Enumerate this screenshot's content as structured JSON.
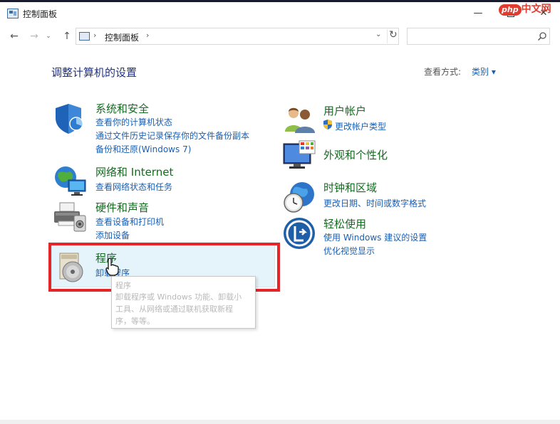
{
  "window": {
    "title": "控制面板",
    "minimize": "—",
    "close": "✕"
  },
  "watermark": {
    "badge": "php",
    "text": "中文网"
  },
  "nav": {
    "back": "←",
    "forward": "→",
    "recent": "⌄",
    "up": "↑",
    "address_text": "控制面板",
    "address_sep": "›",
    "address_dropdown": "⌄",
    "refresh": "↻",
    "search_placeholder": ""
  },
  "content": {
    "heading": "调整计算机的设置",
    "view_by_label": "查看方式:",
    "view_by_value": "类别 ▾"
  },
  "categories": {
    "security": {
      "title": "系统和安全",
      "links": [
        "查看你的计算机状态",
        "通过文件历史记录保存你的文件备份副本",
        "备份和还原(Windows 7)"
      ]
    },
    "network": {
      "title": "网络和 Internet",
      "links": [
        "查看网络状态和任务"
      ]
    },
    "hardware": {
      "title": "硬件和声音",
      "links": [
        "查看设备和打印机",
        "添加设备"
      ]
    },
    "programs": {
      "title": "程序",
      "links": [
        "卸载程序"
      ]
    },
    "accounts": {
      "title": "用户帐户",
      "links": [
        "更改帐户类型"
      ]
    },
    "appearance": {
      "title": "外观和个性化",
      "links": []
    },
    "clock": {
      "title": "时钟和区域",
      "links": [
        "更改日期、时间或数字格式"
      ]
    },
    "ease": {
      "title": "轻松使用",
      "links": [
        "使用 Windows 建议的设置",
        "优化视觉显示"
      ]
    }
  },
  "tooltip": {
    "title": "程序",
    "line1": "卸载程序或 Windows 功能、卸载小",
    "line2": "工具、从网络或通过联机获取新程",
    "line3": "序，等等。"
  },
  "colors": {
    "category_title": "#146b20",
    "link": "#1a5fb4",
    "heading": "#1e3287",
    "hover_bg": "#e5f3fb",
    "annotation_red": "#e4262a"
  }
}
